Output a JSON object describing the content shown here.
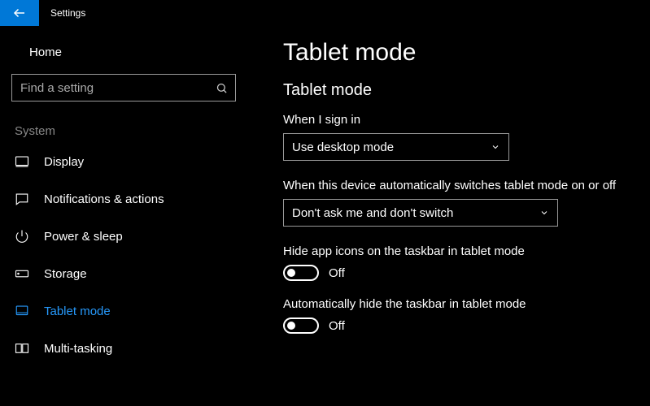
{
  "titlebar": {
    "title": "Settings"
  },
  "sidebar": {
    "home_label": "Home",
    "search_placeholder": "Find a setting",
    "section_label": "System",
    "items": [
      {
        "label": "Display"
      },
      {
        "label": "Notifications & actions"
      },
      {
        "label": "Power & sleep"
      },
      {
        "label": "Storage"
      },
      {
        "label": "Tablet mode"
      },
      {
        "label": "Multi-tasking"
      }
    ]
  },
  "main": {
    "page_title": "Tablet mode",
    "section_title": "Tablet mode",
    "sign_in": {
      "label": "When I sign in",
      "value": "Use desktop mode"
    },
    "auto_switch": {
      "label": "When this device automatically switches tablet mode on or off",
      "value": "Don't ask me and don't switch"
    },
    "hide_icons": {
      "label": "Hide app icons on the taskbar in tablet mode",
      "state": "Off"
    },
    "auto_hide": {
      "label": "Automatically hide the taskbar in tablet mode",
      "state": "Off"
    }
  }
}
